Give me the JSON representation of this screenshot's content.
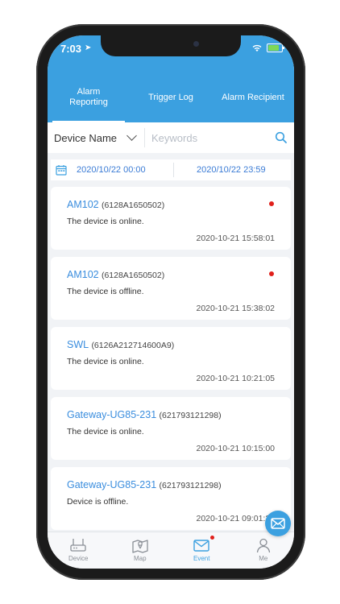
{
  "status": {
    "time": "7:03"
  },
  "tabs": [
    {
      "label": "Alarm\nReporting",
      "active": true
    },
    {
      "label": "Trigger Log",
      "active": false
    },
    {
      "label": "Alarm Recipient",
      "active": false
    }
  ],
  "filter": {
    "device_select": "Device Name",
    "keyword_placeholder": "Keywords"
  },
  "dates": {
    "start": "2020/10/22 00:00",
    "end": "2020/10/22 23:59"
  },
  "events": [
    {
      "name": "AM102",
      "id": "(6128A1650502)",
      "message": "The device is online.",
      "time": "2020-10-21 15:58:01",
      "unread": true
    },
    {
      "name": "AM102",
      "id": "(6128A1650502)",
      "message": "The device is offline.",
      "time": "2020-10-21 15:38:02",
      "unread": true
    },
    {
      "name": "SWL",
      "id": "(6126A212714600A9)",
      "message": "The device is online.",
      "time": "2020-10-21 10:21:05",
      "unread": false
    },
    {
      "name": "Gateway-UG85-231",
      "id": "(621793121298)",
      "message": "The device is online.",
      "time": "2020-10-21 10:15:00",
      "unread": false
    },
    {
      "name": "Gateway-UG85-231",
      "id": "(621793121298)",
      "message": "Device is offline.",
      "time": "2020-10-21 09:01:29",
      "unread": false
    }
  ],
  "nav": [
    {
      "label": "Device",
      "icon": "router-icon",
      "active": false
    },
    {
      "label": "Map",
      "icon": "map-icon",
      "active": false
    },
    {
      "label": "Event",
      "icon": "mail-icon",
      "active": true,
      "badge": true
    },
    {
      "label": "Me",
      "icon": "person-icon",
      "active": false
    }
  ],
  "colors": {
    "primary": "#3ba0e0",
    "alert_dot": "#e0201b",
    "link": "#3a8dde"
  }
}
